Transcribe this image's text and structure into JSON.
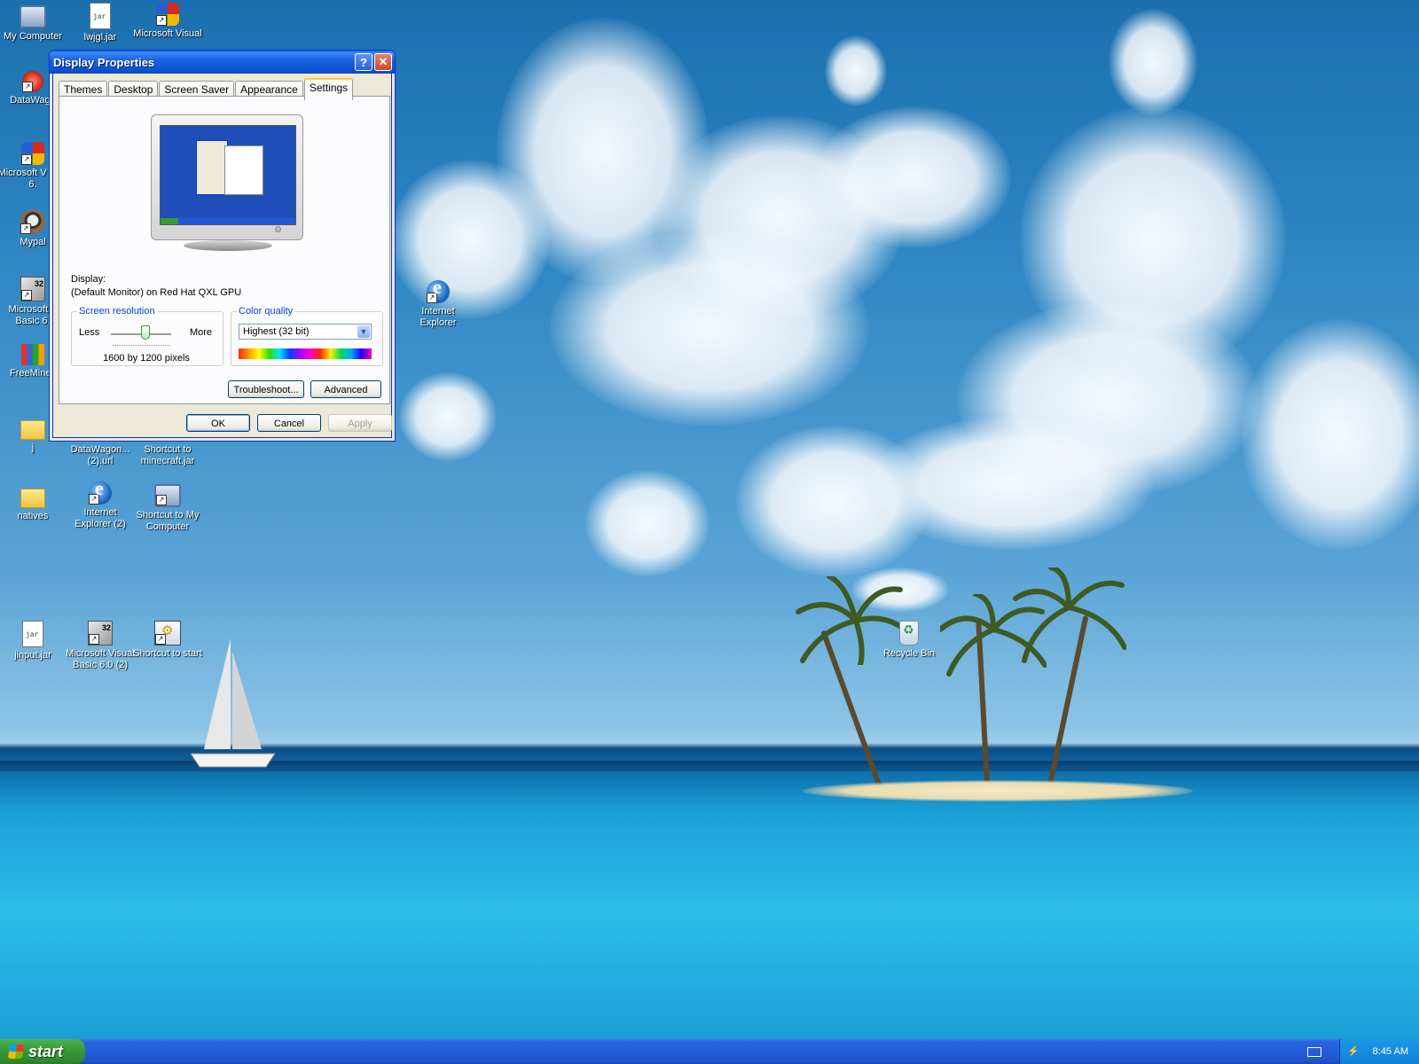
{
  "window": {
    "title": "Display Properties",
    "help_glyph": "?",
    "close_glyph": "✕",
    "tabs": [
      "Themes",
      "Desktop",
      "Screen Saver",
      "Appearance",
      "Settings"
    ],
    "active_tab": "Settings",
    "display_label": "Display:",
    "display_value": "(Default Monitor) on Red Hat QXL GPU",
    "resolution": {
      "legend": "Screen resolution",
      "less": "Less",
      "more": "More",
      "value_text": "1600 by 1200 pixels"
    },
    "color_quality": {
      "legend": "Color quality",
      "selected": "Highest (32 bit)"
    },
    "buttons": {
      "troubleshoot": "Troubleshoot...",
      "advanced": "Advanced",
      "ok": "OK",
      "cancel": "Cancel",
      "apply": "Apply"
    }
  },
  "desktop_icons": {
    "my_computer": "My Computer",
    "lwjgl_jar": "lwjgl.jar",
    "ms_visual": "Microsoft Visual",
    "datawago": "DataWago",
    "ms_vcpp": "Microsoft V C++ 6.",
    "mypal": "Mypal",
    "ms_vb": "Microsoft V Basic 6.",
    "freeminec": "FreeMinec",
    "folder_j": "j",
    "datawagon_url": "DataWagon... (2).url",
    "shortcut_minecraft": "Shortcut to minecraft.jar",
    "natives": "natives",
    "ie2": "Internet Explorer (2)",
    "shortcut_mycomputer": "Shortcut to My Computer",
    "ie": "Internet Explorer",
    "jinput_jar": "jinput.jar",
    "ms_vb2": "Microsoft Visual Basic 6.0 (2)",
    "shortcut_start": "Shortcut to start",
    "recycle_bin": "Recycle Bin"
  },
  "taskbar": {
    "start_label": "start",
    "clock": "8:45 AM"
  }
}
